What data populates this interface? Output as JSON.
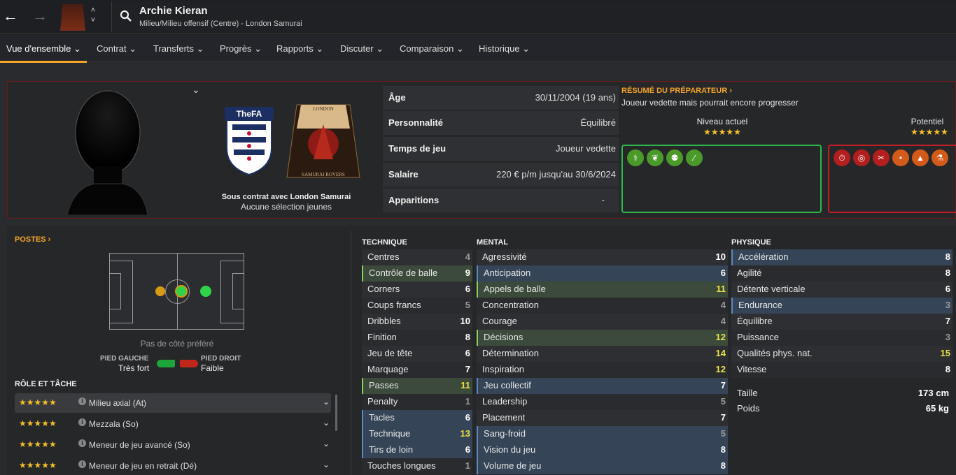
{
  "header": {
    "back_icon": "arrow-left-icon",
    "forward_icon": "arrow-right-icon",
    "search_icon": "search-icon",
    "player_name": "Archie Kieran",
    "player_sub": "Milieu/Milieu offensif (Centre) - London Samurai"
  },
  "tabs": [
    {
      "label": "Vue d'ensemble"
    },
    {
      "label": "Contrat"
    },
    {
      "label": "Transferts"
    },
    {
      "label": "Progrès"
    },
    {
      "label": "Rapports"
    },
    {
      "label": "Discuter"
    },
    {
      "label": "Comparaison"
    },
    {
      "label": "Historique"
    }
  ],
  "profile": {
    "fa_logo": "TheFA",
    "club_crest_top": "LONDON",
    "club_crest_bottom": "SAMURAI ROVERS",
    "contract": "Sous contrat avec London Samurai",
    "youth": "Aucune sélection jeunes"
  },
  "info": [
    {
      "label": "Âge",
      "value": "30/11/2004 (19 ans)"
    },
    {
      "label": "Personnalité",
      "value": "Équilibré"
    },
    {
      "label": "Temps de jeu",
      "value": "Joueur vedette"
    },
    {
      "label": "Salaire",
      "value": "220 € p/m jusqu'au 30/6/2024"
    },
    {
      "label": "Apparitions",
      "value": "-"
    }
  ],
  "coach": {
    "title": "RÉSUMÉ DU PRÉPARATEUR ›",
    "desc": "Joueur vedette mais pourrait encore progresser",
    "current_label": "Niveau actuel",
    "current_stars": 5,
    "potential_label": "Potentiel",
    "potential_stars": 5,
    "strengths": [
      "dna-icon",
      "wings-icon",
      "brain-icon",
      "bone-icon"
    ],
    "weaknesses": [
      "stopwatch-icon",
      "target-icon",
      "scissors-icon",
      "foot-icon",
      "cone-icon",
      "flask-icon"
    ]
  },
  "positions": {
    "title": "POSTES ›",
    "side_pref": "Pas de côté préféré",
    "left_foot_label": "PIED GAUCHE",
    "left_foot_value": "Très fort",
    "right_foot_label": "PIED DROIT",
    "right_foot_value": "Faible"
  },
  "roles": {
    "title": "RÔLE ET TÂCHE",
    "items": [
      {
        "name": "Milieu axial (At)",
        "stars": "★★★★★"
      },
      {
        "name": "Mezzala (So)",
        "stars": "★★★★★"
      },
      {
        "name": "Meneur de jeu avancé (So)",
        "stars": "★★★★★"
      },
      {
        "name": "Meneur de jeu en retrait (Dé)",
        "stars": "★★★★★"
      }
    ]
  },
  "attributes": {
    "technique_title": "TECHNIQUE",
    "mental_title": "MENTAL",
    "physique_title": "PHYSIQUE",
    "technique": [
      {
        "name": "Centres",
        "value": "4",
        "hl": ""
      },
      {
        "name": "Contrôle de balle",
        "value": "9",
        "hl": "g"
      },
      {
        "name": "Corners",
        "value": "6",
        "hl": ""
      },
      {
        "name": "Coups francs",
        "value": "5",
        "hl": ""
      },
      {
        "name": "Dribbles",
        "value": "10",
        "hl": ""
      },
      {
        "name": "Finition",
        "value": "8",
        "hl": ""
      },
      {
        "name": "Jeu de tête",
        "value": "6",
        "hl": ""
      },
      {
        "name": "Marquage",
        "value": "7",
        "hl": ""
      },
      {
        "name": "Passes",
        "value": "11",
        "hl": "g"
      },
      {
        "name": "Penalty",
        "value": "1",
        "hl": ""
      },
      {
        "name": "Tacles",
        "value": "6",
        "hl": "b"
      },
      {
        "name": "Technique",
        "value": "13",
        "hl": "b"
      },
      {
        "name": "Tirs de loin",
        "value": "6",
        "hl": "b"
      },
      {
        "name": "Touches longues",
        "value": "1",
        "hl": ""
      }
    ],
    "mental": [
      {
        "name": "Agressivité",
        "value": "10",
        "hl": ""
      },
      {
        "name": "Anticipation",
        "value": "6",
        "hl": "b"
      },
      {
        "name": "Appels de balle",
        "value": "11",
        "hl": "g"
      },
      {
        "name": "Concentration",
        "value": "4",
        "hl": ""
      },
      {
        "name": "Courage",
        "value": "4",
        "hl": ""
      },
      {
        "name": "Décisions",
        "value": "12",
        "hl": "g"
      },
      {
        "name": "Détermination",
        "value": "14",
        "hl": ""
      },
      {
        "name": "Inspiration",
        "value": "12",
        "hl": ""
      },
      {
        "name": "Jeu collectif",
        "value": "7",
        "hl": "b"
      },
      {
        "name": "Leadership",
        "value": "5",
        "hl": ""
      },
      {
        "name": "Placement",
        "value": "7",
        "hl": ""
      },
      {
        "name": "Sang-froid",
        "value": "5",
        "hl": "b"
      },
      {
        "name": "Vision du jeu",
        "value": "8",
        "hl": "b"
      },
      {
        "name": "Volume de jeu",
        "value": "8",
        "hl": "b"
      }
    ],
    "physique": [
      {
        "name": "Accélération",
        "value": "8",
        "hl": "b"
      },
      {
        "name": "Agilité",
        "value": "8",
        "hl": ""
      },
      {
        "name": "Détente verticale",
        "value": "6",
        "hl": ""
      },
      {
        "name": "Endurance",
        "value": "3",
        "hl": "b"
      },
      {
        "name": "Équilibre",
        "value": "7",
        "hl": ""
      },
      {
        "name": "Puissance",
        "value": "3",
        "hl": ""
      },
      {
        "name": "Qualités phys. nat.",
        "value": "15",
        "hl": ""
      },
      {
        "name": "Vitesse",
        "value": "8",
        "hl": ""
      }
    ],
    "height_label": "Taille",
    "height": "173 cm",
    "weight_label": "Poids",
    "weight": "65 kg"
  }
}
